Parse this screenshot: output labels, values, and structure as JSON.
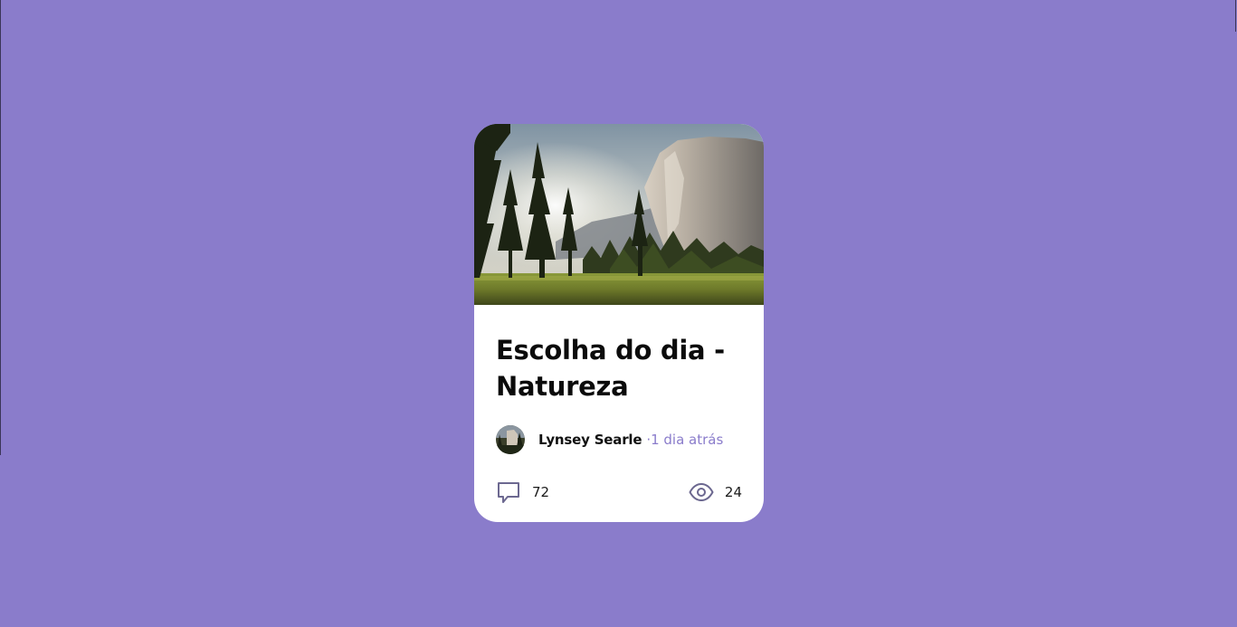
{
  "card": {
    "image_alt": "Forest meadow with granite cliff",
    "title": "Escolha do dia - Natureza",
    "author": {
      "name": "Lynsey Searle",
      "separator": "·",
      "time_ago": "1 dia atrás"
    },
    "stats": {
      "comments": {
        "icon": "speech-bubble-icon",
        "count": "72"
      },
      "views": {
        "icon": "eye-icon",
        "count": "24"
      }
    }
  },
  "colors": {
    "background": "#8a7ccb",
    "card": "#ffffff",
    "accent": "#8a7ccb",
    "icon_stroke": "#6c6890"
  }
}
